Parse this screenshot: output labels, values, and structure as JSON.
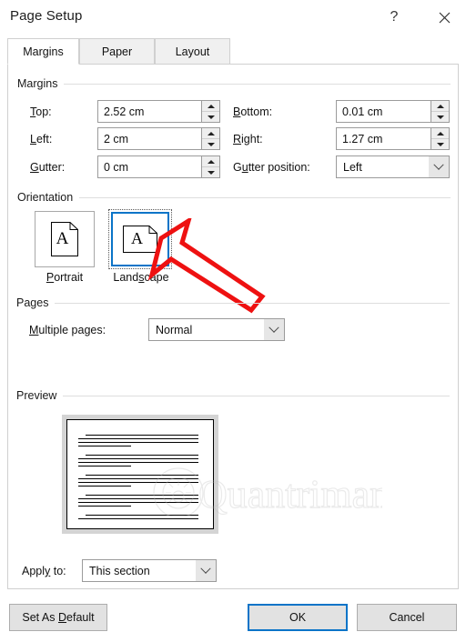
{
  "window": {
    "title": "Page Setup",
    "help_icon": "question-mark-icon",
    "close_icon": "close-icon"
  },
  "tabs": [
    {
      "label": "Margins",
      "active": true
    },
    {
      "label": "Paper",
      "active": false
    },
    {
      "label": "Layout",
      "active": false
    }
  ],
  "margins_group": {
    "title": "Margins",
    "top": {
      "label": "Top:",
      "value": "2.52 cm"
    },
    "bottom": {
      "label": "Bottom:",
      "value": "0.01 cm"
    },
    "left": {
      "label": "Left:",
      "value": "2 cm"
    },
    "right": {
      "label": "Right:",
      "value": "1.27 cm"
    },
    "gutter": {
      "label": "Gutter:",
      "value": "0 cm"
    },
    "gutter_position": {
      "label": "Gutter position:",
      "value": "Left"
    }
  },
  "orientation_group": {
    "title": "Orientation",
    "portrait": {
      "label": "Portrait",
      "selected": false,
      "glyph": "A"
    },
    "landscape": {
      "label": "Landscape",
      "selected": true,
      "glyph": "A"
    }
  },
  "pages_group": {
    "title": "Pages",
    "multiple_pages": {
      "label": "Multiple pages:",
      "value": "Normal"
    }
  },
  "preview_group": {
    "title": "Preview",
    "watermark_text": "Quantrimang"
  },
  "apply_to": {
    "label": "Apply to:",
    "value": "This section"
  },
  "footer": {
    "set_as_default": "Set As Default",
    "ok": "OK",
    "cancel": "Cancel"
  },
  "colors": {
    "accent": "#0a74c8",
    "annotation": "#ee1111",
    "dialog_bg": "#ffffff",
    "button_face": "#e2e2e2"
  }
}
